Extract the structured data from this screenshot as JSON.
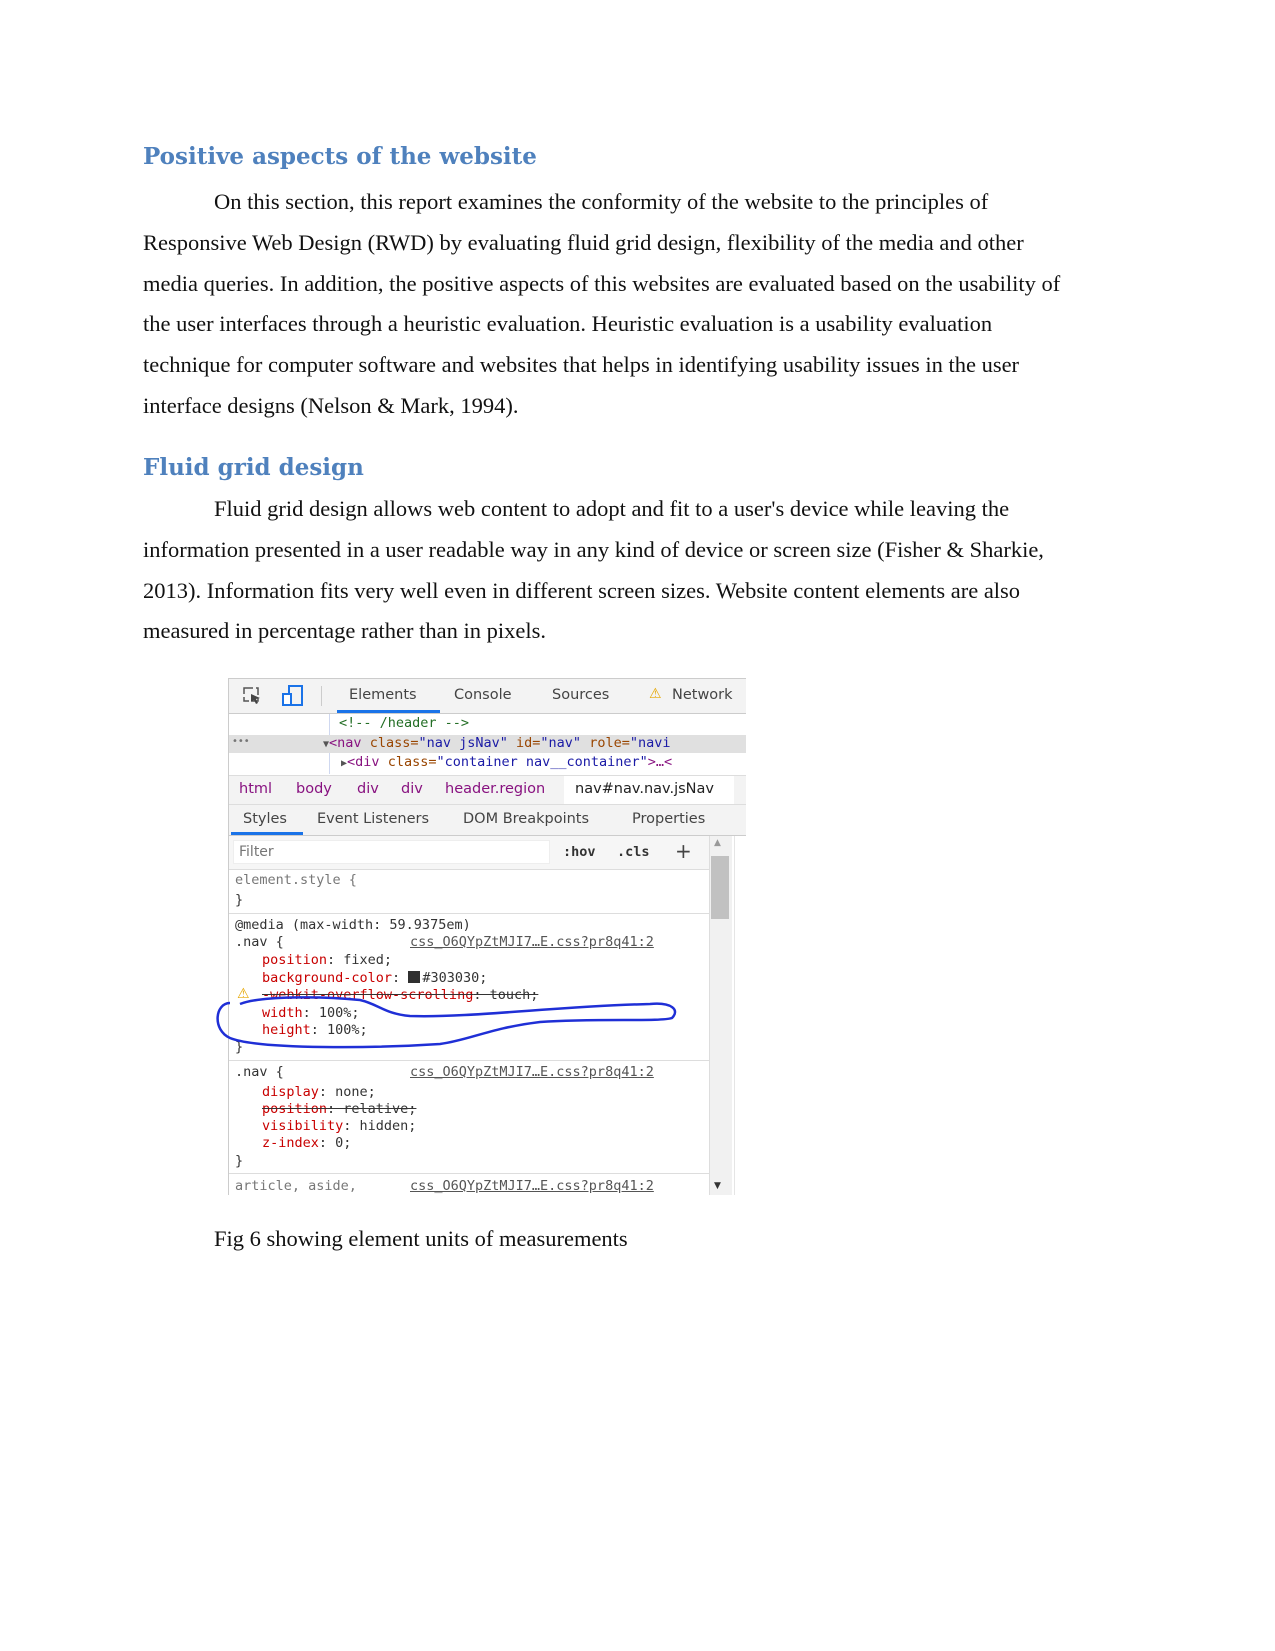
{
  "sections": [
    {
      "heading": "Positive aspects of the website",
      "paragraph": "On this section, this report examines the conformity of the website to the principles of Responsive Web Design (RWD) by evaluating fluid grid design, flexibility of the media and other media queries. In addition, the positive aspects of this websites are evaluated based on the usability of the user interfaces through a heuristic evaluation. Heuristic evaluation is a usability evaluation technique for computer software and websites that helps in identifying usability issues in the user interface designs (Nelson & Mark, 1994)."
    },
    {
      "heading": "Fluid grid design",
      "paragraph": "Fluid grid design allows web content to adopt and fit to a user's device while leaving the information presented in a user readable way in any kind of device or screen size (Fisher & Sharkie, 2013). Information fits very well even in different screen sizes. Website content elements are also measured in percentage rather than in pixels."
    }
  ],
  "figure": {
    "caption": "Fig 6 showing element units of measurements",
    "devtools": {
      "tabs": [
        "Elements",
        "Console",
        "Sources",
        "Network"
      ],
      "active_tab": "Elements",
      "dom": {
        "comment": "<!-- /header -->",
        "nav_tag": "<nav",
        "nav_class_attr": "class=",
        "nav_class_val": "\"nav jsNav\"",
        "nav_id_attr": "id=",
        "nav_id_val": "\"nav\"",
        "nav_role_attr": "role=",
        "nav_role_val": "\"navi",
        "div_tag": "<div",
        "div_class_attr": "class=",
        "div_class_val": "\"container nav__container\"",
        "div_end": ">…<",
        "ellipsis": "•••"
      },
      "breadcrumb": [
        "html",
        "body",
        "div",
        "div",
        "header.region",
        "nav#nav.nav.jsNav"
      ],
      "subtabs": [
        "Styles",
        "Event Listeners",
        "DOM Breakpoints",
        "Properties"
      ],
      "filter_placeholder": "Filter",
      "hov": ":hov",
      "cls": ".cls",
      "plus": "+",
      "element_style": "element.style {",
      "close": "}",
      "media": "@media (max-width: 59.9375em)",
      "rule1": {
        "selector": ".nav {",
        "source": "css_O6QYpZtMJI7…E.css?pr8q41:2",
        "props": [
          [
            "position",
            ": fixed;"
          ],
          [
            "background-color",
            ": ",
            ";"
          ],
          [
            "-webkit-overflow-scrolling",
            ": touch;"
          ],
          [
            "width",
            ": 100%;"
          ],
          [
            "height",
            ": 100%;"
          ]
        ],
        "bg_value": "#303030"
      },
      "rule2": {
        "selector": ".nav {",
        "source": "css_O6QYpZtMJI7…E.css?pr8q41:2",
        "props": [
          [
            "display",
            ": none;"
          ],
          [
            "position",
            ": relative;"
          ],
          [
            "visibility",
            ": hidden;"
          ],
          [
            "z-index",
            ": 0;"
          ]
        ]
      },
      "rule3": {
        "selector": "article, aside,",
        "source": "css_O6QYpZtMJI7…E.css?pr8q41:2"
      },
      "annotation_color": "#1f2fd6",
      "swatch_color": "#303030"
    }
  }
}
